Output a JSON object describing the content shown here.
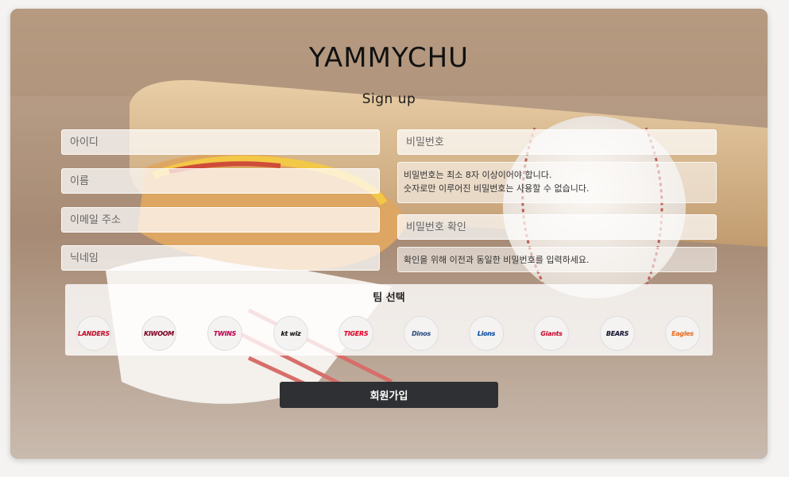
{
  "header": {
    "title": "YAMMYCHU",
    "subtitle": "Sign up"
  },
  "form": {
    "id_placeholder": "아이디",
    "name_placeholder": "이름",
    "email_placeholder": "이메일 주소",
    "nickname_placeholder": "닉네임",
    "password_placeholder": "비밀번호",
    "password_hint_line1": "비밀번호는 최소 8자 이상이어야 합니다.",
    "password_hint_line2": "숫자로만 이루어진 비밀번호는 사용할 수 없습니다.",
    "password_confirm_placeholder": "비밀번호 확인",
    "password_confirm_hint": "확인을 위해 이전과 동일한 비밀번호를 입력하세요."
  },
  "teams": {
    "title": "팀 선택",
    "items": [
      {
        "label": "LANDERS",
        "color": "#c8102e"
      },
      {
        "label": "KIWOOM",
        "color": "#820024"
      },
      {
        "label": "TWINS",
        "color": "#c30452"
      },
      {
        "label": "kt wiz",
        "color": "#111111"
      },
      {
        "label": "TIGERS",
        "color": "#ea0029"
      },
      {
        "label": "Dinos",
        "color": "#315288"
      },
      {
        "label": "Lions",
        "color": "#074ca1"
      },
      {
        "label": "Giants",
        "color": "#d00f31"
      },
      {
        "label": "BEARS",
        "color": "#131230"
      },
      {
        "label": "Eagles",
        "color": "#f37321"
      }
    ]
  },
  "actions": {
    "signup_label": "회원가입"
  }
}
